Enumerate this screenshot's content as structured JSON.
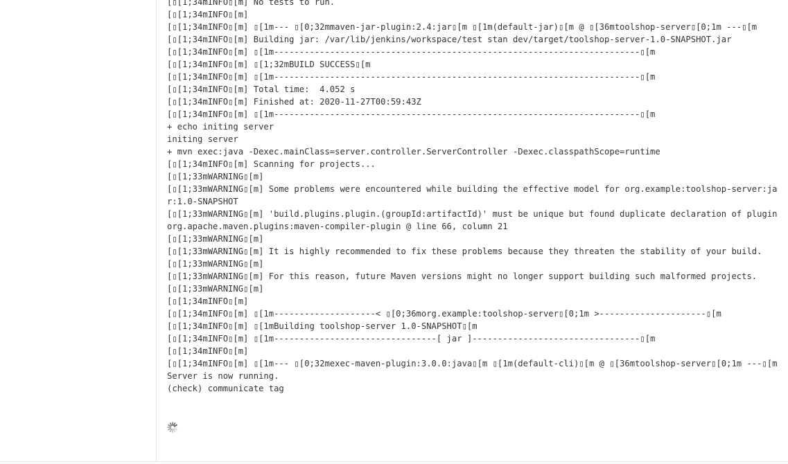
{
  "console": {
    "lines": [
      "[\u001b[1;34mINFO\u001b[m] No tests to run.",
      "[\u001b[1;34mINFO\u001b[m]",
      "[\u001b[1;34mINFO\u001b[m] \u001b[1m--- \u001b[0;32mmaven-jar-plugin:2.4:jar\u001b[m \u001b[1m(default-jar)\u001b[m @ \u001b[36mtoolshop-server\u001b[0;1m ---\u001b[m",
      "[\u001b[1;34mINFO\u001b[m] Building jar: /var/lib/jenkins/workspace/test stan dev/target/toolshop-server-1.0-SNAPSHOT.jar",
      "[\u001b[1;34mINFO\u001b[m] \u001b[1m------------------------------------------------------------------------\u001b[m",
      "[\u001b[1;34mINFO\u001b[m] \u001b[1;32mBUILD SUCCESS\u001b[m",
      "[\u001b[1;34mINFO\u001b[m] \u001b[1m------------------------------------------------------------------------\u001b[m",
      "[\u001b[1;34mINFO\u001b[m] Total time:  4.052 s",
      "[\u001b[1;34mINFO\u001b[m] Finished at: 2020-11-27T00:59:43Z",
      "[\u001b[1;34mINFO\u001b[m] \u001b[1m------------------------------------------------------------------------\u001b[m",
      "+ echo initing server",
      "initing server",
      "+ mvn exec:java -Dexec.mainClass=server.controller.ServerController -Dexec.classpathScope=runtime",
      "[\u001b[1;34mINFO\u001b[m] Scanning for projects...",
      "[\u001b[1;33mWARNING\u001b[m]",
      "[\u001b[1;33mWARNING\u001b[m] Some problems were encountered while building the effective model for org.example:toolshop-server:jar:1.0-SNAPSHOT",
      "[\u001b[1;33mWARNING\u001b[m] 'build.plugins.plugin.(groupId:artifactId)' must be unique but found duplicate declaration of plugin org.apache.maven.plugins:maven-compiler-plugin @ line 66, column 21",
      "[\u001b[1;33mWARNING\u001b[m]",
      "[\u001b[1;33mWARNING\u001b[m] It is highly recommended to fix these problems because they threaten the stability of your build.",
      "[\u001b[1;33mWARNING\u001b[m]",
      "[\u001b[1;33mWARNING\u001b[m] For this reason, future Maven versions might no longer support building such malformed projects.",
      "[\u001b[1;33mWARNING\u001b[m]",
      "[\u001b[1;34mINFO\u001b[m]",
      "[\u001b[1;34mINFO\u001b[m] \u001b[1m--------------------< \u001b[0;36morg.example:toolshop-server\u001b[0;1m >---------------------\u001b[m",
      "[\u001b[1;34mINFO\u001b[m] \u001b[1mBuilding toolshop-server 1.0-SNAPSHOT\u001b[m",
      "[\u001b[1;34mINFO\u001b[m] \u001b[1m--------------------------------[ jar ]---------------------------------\u001b[m",
      "[\u001b[1;34mINFO\u001b[m]",
      "[\u001b[1;34mINFO\u001b[m] \u001b[1m--- \u001b[0;32mexec-maven-plugin:3.0.0:java\u001b[m \u001b[1m(default-cli)\u001b[m @ \u001b[36mtoolshop-server\u001b[0;1m ---\u001b[m",
      "Server is now running.",
      "(check) communicate tag"
    ]
  },
  "spinner": {
    "icon": "loading-spinner-icon",
    "color": "#555555"
  }
}
